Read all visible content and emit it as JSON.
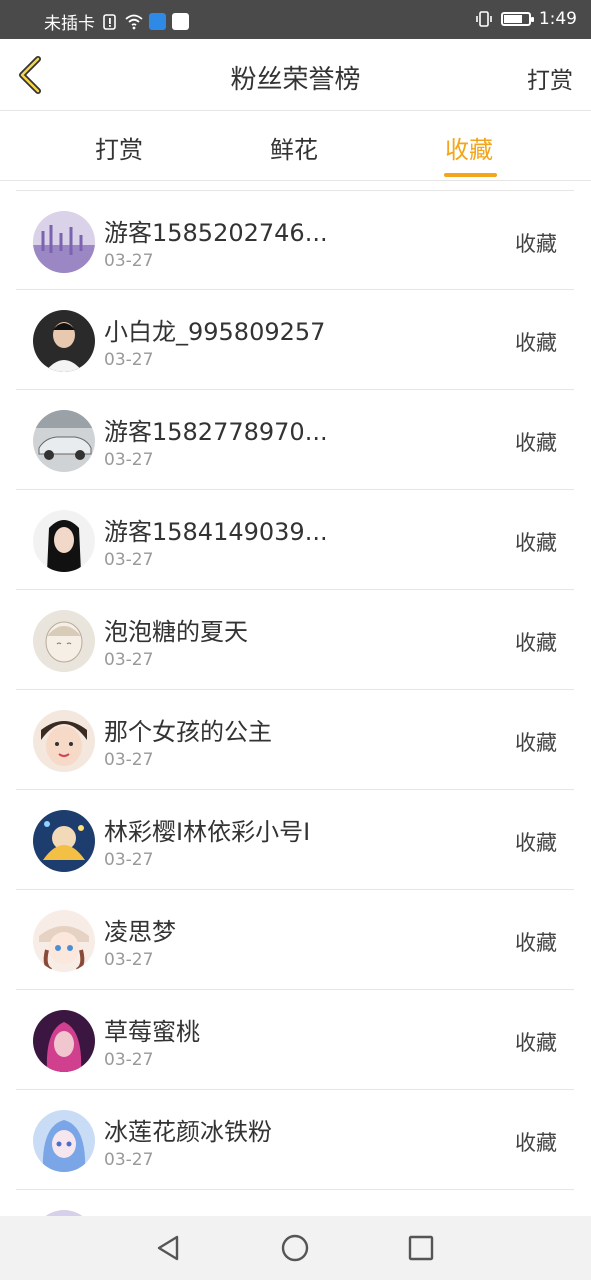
{
  "status_bar": {
    "carrier": "未插卡",
    "time": "1:49"
  },
  "header": {
    "title": "粉丝荣誉榜",
    "action_label": "打赏"
  },
  "tabs": [
    {
      "label": "打赏",
      "active": false
    },
    {
      "label": "鲜花",
      "active": false
    },
    {
      "label": "收藏",
      "active": true
    }
  ],
  "colors": {
    "accent": "#f3a51b",
    "status_bar": "#4a4a4a"
  },
  "fans": [
    {
      "name": "游客1585202746...",
      "date": "03-27",
      "action": "收藏",
      "avatar": "lavender-photo"
    },
    {
      "name": "小白龙_995809257",
      "date": "03-27",
      "action": "收藏",
      "avatar": "man-photo"
    },
    {
      "name": "游客1582778970...",
      "date": "03-27",
      "action": "收藏",
      "avatar": "car-photo"
    },
    {
      "name": "游客1584149039...",
      "date": "03-27",
      "action": "收藏",
      "avatar": "woman-photo"
    },
    {
      "name": "泡泡糖的夏天",
      "date": "03-27",
      "action": "收藏",
      "avatar": "anime-sketch"
    },
    {
      "name": "那个女孩的公主",
      "date": "03-27",
      "action": "收藏",
      "avatar": "girl-photo"
    },
    {
      "name": "林彩樱I林依彩小号I",
      "date": "03-27",
      "action": "收藏",
      "avatar": "anime-blue"
    },
    {
      "name": "凌思梦",
      "date": "03-27",
      "action": "收藏",
      "avatar": "anime-girl"
    },
    {
      "name": "草莓蜜桃",
      "date": "03-27",
      "action": "收藏",
      "avatar": "pink-hair-anime"
    },
    {
      "name": "冰莲花颜冰铁粉",
      "date": "03-27",
      "action": "收藏",
      "avatar": "blue-anime"
    }
  ],
  "nav": {
    "back_icon": "triangle-back-icon",
    "home_icon": "circle-home-icon",
    "recent_icon": "square-recents-icon"
  }
}
